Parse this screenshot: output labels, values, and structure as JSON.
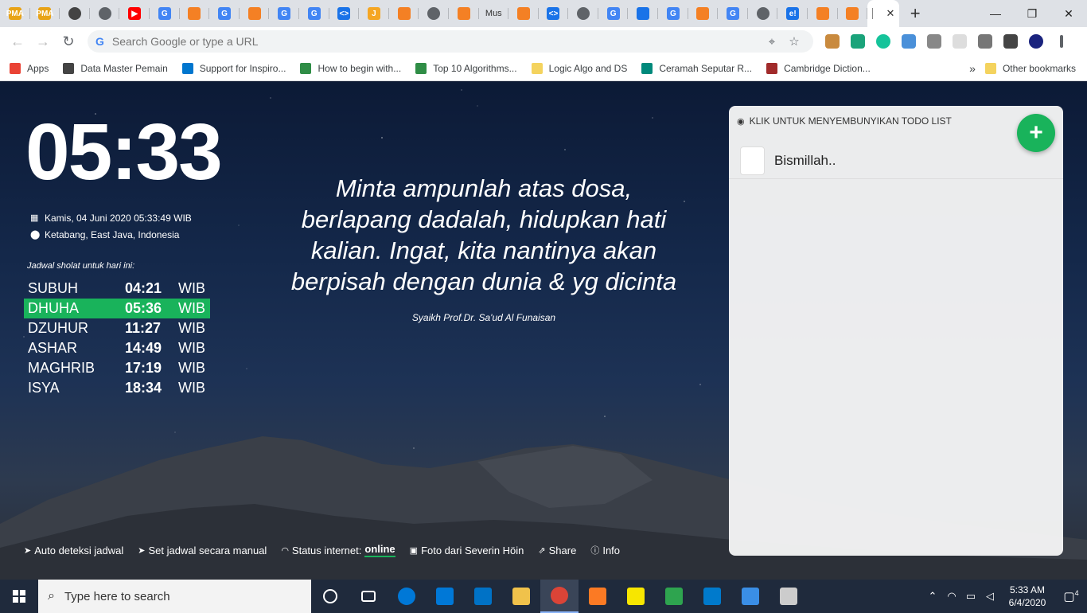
{
  "browser": {
    "tabs": [
      {
        "icon": "pma-icon",
        "color": "#e8a317",
        "text": "PMA"
      },
      {
        "icon": "pma-icon",
        "color": "#e8a317",
        "text": "PMA"
      },
      {
        "icon": "robot-icon",
        "color": "#444444",
        "text": ""
      },
      {
        "icon": "globe-icon",
        "color": "#5f6368",
        "text": ""
      },
      {
        "icon": "youtube-icon",
        "color": "#ff0000",
        "text": "▶"
      },
      {
        "icon": "google-icon",
        "color": "#4285f4",
        "text": "G"
      },
      {
        "icon": "stackoverflow-icon",
        "color": "#f48024",
        "text": ""
      },
      {
        "icon": "google-icon",
        "color": "#4285f4",
        "text": "G"
      },
      {
        "icon": "stackoverflow-icon",
        "color": "#f48024",
        "text": ""
      },
      {
        "icon": "google-icon",
        "color": "#4285f4",
        "text": "G"
      },
      {
        "icon": "google-icon",
        "color": "#4285f4",
        "text": "G"
      },
      {
        "icon": "code-icon",
        "color": "#1a73e8",
        "text": "<>"
      },
      {
        "icon": "jira-icon",
        "color": "#f5a623",
        "text": "J"
      },
      {
        "icon": "stackoverflow-icon",
        "color": "#f48024",
        "text": ""
      },
      {
        "icon": "globe-icon",
        "color": "#5f6368",
        "text": ""
      },
      {
        "icon": "stackoverflow-icon",
        "color": "#f48024",
        "text": ""
      },
      {
        "icon": "mus-tab",
        "color": "",
        "text": "Mus"
      },
      {
        "icon": "stackoverflow-icon",
        "color": "#f48024",
        "text": ""
      },
      {
        "icon": "code-icon",
        "color": "#1a73e8",
        "text": "<>"
      },
      {
        "icon": "paper-plane-icon",
        "color": "#5f6368",
        "text": ""
      },
      {
        "icon": "google-icon",
        "color": "#4285f4",
        "text": "G"
      },
      {
        "icon": "moon-icon",
        "color": "#1a73e8",
        "text": ""
      },
      {
        "icon": "google-icon",
        "color": "#4285f4",
        "text": "G"
      },
      {
        "icon": "stackoverflow-icon",
        "color": "#f48024",
        "text": ""
      },
      {
        "icon": "google-icon",
        "color": "#4285f4",
        "text": "G"
      },
      {
        "icon": "paper-plane-icon",
        "color": "#5f6368",
        "text": ""
      },
      {
        "icon": "ebay-icon",
        "color": "#1a73e8",
        "text": "e!"
      },
      {
        "icon": "stackoverflow-icon",
        "color": "#f48024",
        "text": ""
      },
      {
        "icon": "stackoverflow-icon",
        "color": "#f48024",
        "text": ""
      }
    ],
    "new_tab_label": "+",
    "close_tab_label": "✕",
    "minimize_label": "—",
    "maximize_label": "❐",
    "close_label": "✕",
    "back_icon": "←",
    "forward_icon": "→",
    "reload_icon": "↻",
    "omnibox_placeholder": "Search Google or type a URL",
    "google_icon_text": "G",
    "location_icon": "⌖",
    "star_icon": "☆",
    "extensions": [
      {
        "icon": "cookie-icon",
        "color": "#c98a3e"
      },
      {
        "icon": "notion-icon",
        "color": "#1aa37a"
      },
      {
        "icon": "grammarly-icon",
        "color": "#15c39a"
      },
      {
        "icon": "calendar-ext-icon",
        "color": "#4a90d9"
      },
      {
        "icon": "vuetify-icon",
        "color": "#888888"
      },
      {
        "icon": "blank-ext-icon",
        "color": "#dddddd"
      },
      {
        "icon": "camera-ext-icon",
        "color": "#777777"
      },
      {
        "icon": "media-icon",
        "color": "#444444"
      },
      {
        "icon": "profile-avatar-icon",
        "color": "#1a237e"
      },
      {
        "icon": "menu-dots-icon",
        "color": "#5f6368"
      }
    ],
    "bookmarks": [
      {
        "label": "Apps",
        "icon": "apps-grid-icon",
        "color": "#ea4335"
      },
      {
        "label": "Data Master Pemain",
        "icon": "robot-icon",
        "color": "#444444"
      },
      {
        "label": "Support for Inspiro...",
        "icon": "dell-icon",
        "color": "#0076ce"
      },
      {
        "label": "How to begin with...",
        "icon": "geeksforgeeks-icon",
        "color": "#2f8d46"
      },
      {
        "label": "Top 10 Algorithms...",
        "icon": "geeksforgeeks-icon",
        "color": "#2f8d46"
      },
      {
        "label": "Logic Algo and DS",
        "icon": "folder-icon",
        "color": "#f4d35e"
      },
      {
        "label": "Ceramah Seputar R...",
        "icon": "c-icon",
        "color": "#00897b"
      },
      {
        "label": "Cambridge Diction...",
        "icon": "cambridge-icon",
        "color": "#a12b2b"
      }
    ],
    "bookmarks_more": "»",
    "other_bookmarks": "Other bookmarks"
  },
  "clock": {
    "time": "05:33",
    "date": "Kamis, 04 Juni 2020 05:33:49 WIB",
    "location": "Ketabang, East Java, Indonesia"
  },
  "schedule": {
    "title": "Jadwal sholat untuk hari ini:",
    "rows": [
      {
        "name": "SUBUH",
        "time": "04:21",
        "zone": "WIB",
        "active": false
      },
      {
        "name": "DHUHA",
        "time": "05:36",
        "zone": "WIB",
        "active": true
      },
      {
        "name": "DZUHUR",
        "time": "11:27",
        "zone": "WIB",
        "active": false
      },
      {
        "name": "ASHAR",
        "time": "14:49",
        "zone": "WIB",
        "active": false
      },
      {
        "name": "MAGHRIB",
        "time": "17:19",
        "zone": "WIB",
        "active": false
      },
      {
        "name": "ISYA",
        "time": "18:34",
        "zone": "WIB",
        "active": false
      }
    ]
  },
  "quote": {
    "text": "Minta ampunlah atas dosa, berlapang dadalah, hidupkan hati kalian. Ingat, kita nantinya akan berpisah dengan dunia & yg dicinta",
    "author": "Syaikh Prof.Dr. Sa'ud Al Funaisan"
  },
  "footer": {
    "auto_detect": "Auto deteksi jadwal",
    "manual": "Set jadwal secara manual",
    "status_label": "Status internet:",
    "status_value": "online",
    "photo_credit": "Foto dari Severin Höin",
    "share": "Share",
    "info": "Info"
  },
  "todo": {
    "header": "KLIK UNTUK MENYEMBUNYIKAN TODO LIST",
    "add_label": "+",
    "items": [
      {
        "text": "Bismillah.."
      }
    ]
  },
  "taskbar": {
    "search_placeholder": "Type here to search",
    "apps": [
      {
        "icon": "cortana-icon",
        "color": "#ffffff"
      },
      {
        "icon": "task-view-icon",
        "color": "#ffffff"
      },
      {
        "icon": "edge-icon",
        "color": "#0078d7"
      },
      {
        "icon": "store-icon",
        "color": "#0078d7"
      },
      {
        "icon": "mail-icon",
        "color": "#0072c6"
      },
      {
        "icon": "file-explorer-icon",
        "color": "#f0c24b"
      },
      {
        "icon": "chrome-icon",
        "color": "#db4437"
      },
      {
        "icon": "xampp-icon",
        "color": "#fb7a24"
      },
      {
        "icon": "sticky-notes-icon",
        "color": "#f7e600"
      },
      {
        "icon": "git-icon",
        "color": "#2ea44f"
      },
      {
        "icon": "vscode-icon",
        "color": "#007acc"
      },
      {
        "icon": "photos-icon",
        "color": "#3a8ee6"
      },
      {
        "icon": "calculator-icon",
        "color": "#cccccc"
      }
    ],
    "tray_time": "5:33 AM",
    "tray_date": "6/4/2020",
    "notification_count": "4"
  }
}
